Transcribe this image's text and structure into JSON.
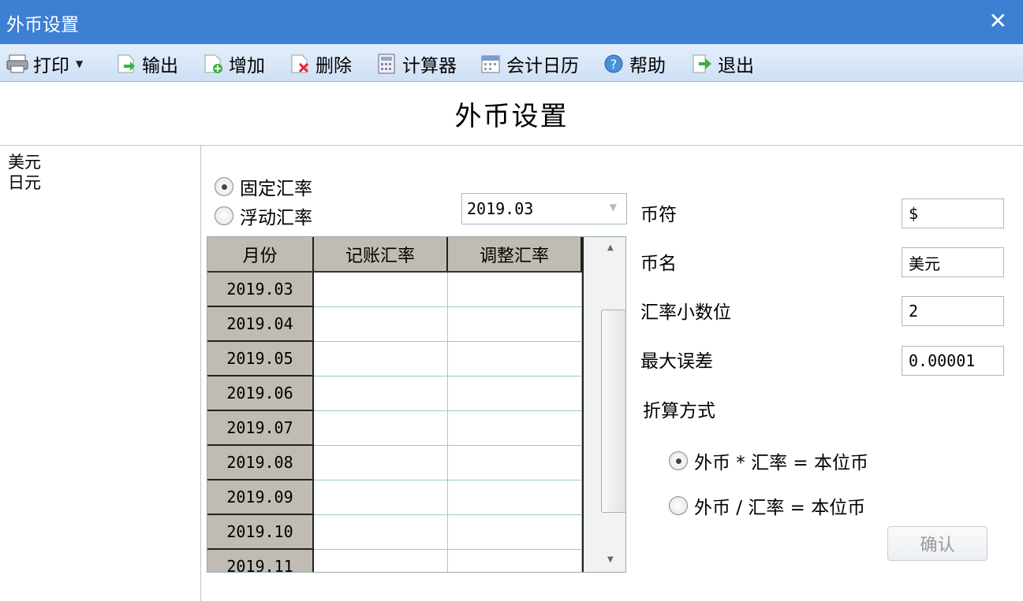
{
  "window": {
    "title": "外币设置",
    "close_symbol": "✕"
  },
  "toolbar": {
    "print": "打印",
    "export": "输出",
    "add": "增加",
    "delete": "删除",
    "calculator": "计算器",
    "calendar": "会计日历",
    "help": "帮助",
    "exit": "退出"
  },
  "heading": "外币设置",
  "currencies": [
    "美元",
    "日元"
  ],
  "rate_mode": {
    "fixed": "固定汇率",
    "floating": "浮动汇率",
    "selected": "fixed"
  },
  "period_select": {
    "value": "2019.03"
  },
  "grid": {
    "headers": [
      "月份",
      "记账汇率",
      "调整汇率"
    ],
    "rows": [
      [
        "2019.03",
        "",
        ""
      ],
      [
        "2019.04",
        "",
        ""
      ],
      [
        "2019.05",
        "",
        ""
      ],
      [
        "2019.06",
        "",
        ""
      ],
      [
        "2019.07",
        "",
        ""
      ],
      [
        "2019.08",
        "",
        ""
      ],
      [
        "2019.09",
        "",
        ""
      ],
      [
        "2019.10",
        "",
        ""
      ],
      [
        "2019.11",
        "",
        ""
      ]
    ]
  },
  "form": {
    "symbol_label": "币符",
    "symbol_value": "$",
    "name_label": "币名",
    "name_value": "美元",
    "decimals_label": "汇率小数位",
    "decimals_value": "2",
    "max_error_label": "最大误差",
    "max_error_value": "0.00001",
    "conversion_label": "折算方式",
    "conv_multiply": "外币 * 汇率 = 本位币",
    "conv_divide": "外币 / 汇率 = 本位币",
    "conv_selected": "multiply"
  },
  "confirm_button": "确认",
  "colors": {
    "titlebar": "#3d7fd3",
    "toolbar": "#d6e5f7",
    "grid_header": "#c0bcb4"
  }
}
